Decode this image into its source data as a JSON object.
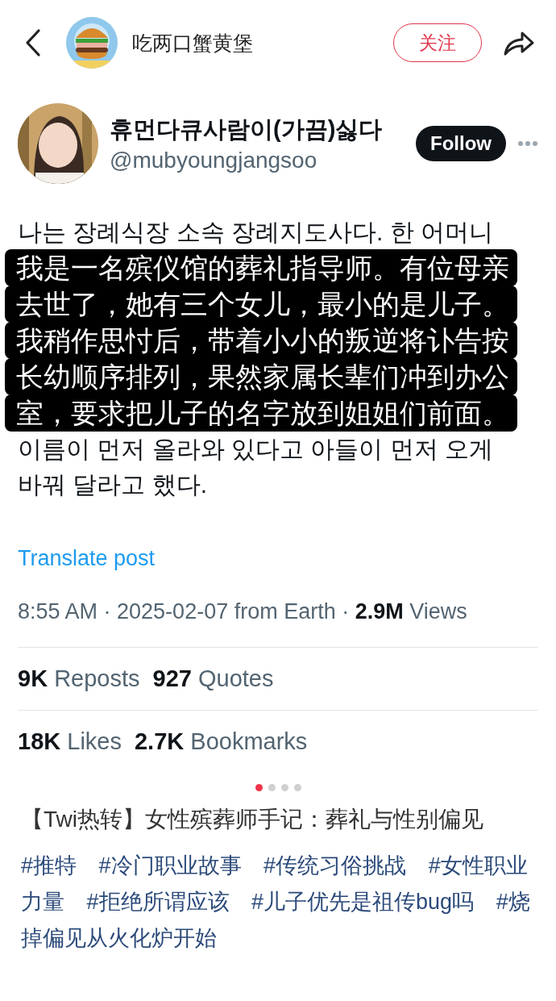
{
  "top_bar": {
    "author": "吃两口蟹黄堡",
    "follow_button": "关注"
  },
  "tweet": {
    "display_name": "휴먼다큐사람이(가끔)싫다",
    "handle": "@mubyoungjangsoo",
    "follow_button": "Follow",
    "body_before": [
      "나는 장례식장 소속 장례지도사다. 한 어머니"
    ],
    "translation_lines": [
      "我是一名殡仪馆的葬礼指导师。有位母亲",
      "去世了，她有三个女儿，最小的是儿子。",
      "我稍作思忖后，带着小小的叛逆将讣告按",
      "长幼顺序排列，果然家属长辈们冲到办公",
      "室，要求把儿子的名字放到姐姐们前面。"
    ],
    "body_after": [
      "이름이 먼저 올라와 있다고 아들이 먼저 오게",
      "바꿔 달라고 했다."
    ],
    "translate_link": "Translate post",
    "meta": "8:55 AM · 2025-02-07 from Earth · **2.9M** Views",
    "stat_rows": [
      [
        {
          "count": "9K",
          "label": "Reposts"
        },
        {
          "count": "927",
          "label": "Quotes"
        }
      ],
      [
        {
          "count": "18K",
          "label": "Likes"
        },
        {
          "count": "2.7K",
          "label": "Bookmarks"
        }
      ]
    ]
  },
  "carousel": {
    "pages": [
      {
        "selected": true
      },
      {
        "selected": false
      },
      {
        "selected": false
      },
      {
        "selected": false
      }
    ]
  },
  "note": {
    "title": "【Twi热转】女性殡葬师手记：葬礼与性别偏见",
    "tags": [
      "#推特",
      "#冷门职业故事",
      "#传统习俗挑战",
      "#女性职业力量",
      "#拒绝所谓应该",
      "#儿子优先是祖传bug吗",
      "#烧掉偏见从火化炉开始"
    ]
  }
}
